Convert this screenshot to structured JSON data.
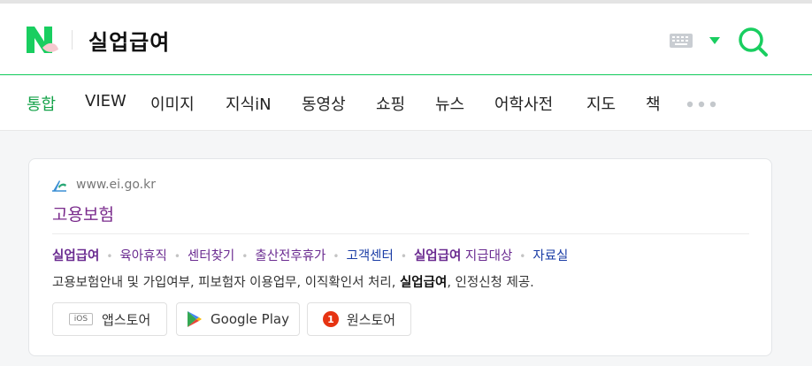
{
  "search": {
    "query": "실업급여"
  },
  "tabs": [
    {
      "label": "통합",
      "active": true
    },
    {
      "label": "VIEW"
    },
    {
      "label": "이미지"
    },
    {
      "label": "지식iN"
    },
    {
      "label": "동영상"
    },
    {
      "label": "쇼핑"
    },
    {
      "label": "뉴스"
    },
    {
      "label": "어학사전"
    },
    {
      "label": "지도"
    },
    {
      "label": "책"
    }
  ],
  "result": {
    "url": "www.ei.go.kr",
    "title": "고용보험",
    "sublinks": [
      "실업급여",
      "육아휴직",
      "센터찾기",
      "출산전후휴가",
      "고객센터",
      "실업급여",
      "지급대상",
      "자료실"
    ],
    "desc_before": "고용보험안내 및 가입여부, 피보험자 이용업무, 이직확인서 처리, ",
    "desc_bold": "실업급여",
    "desc_after": ", 인정신청 제공.",
    "stores": {
      "ios_badge": "iOS",
      "appstore": "앱스토어",
      "googleplay": "Google Play",
      "one_badge": "1",
      "onestore": "원스토어"
    }
  },
  "colors": {
    "brand": "#19ce60",
    "visited": "#7a2b8c",
    "link": "#1b3da6"
  }
}
